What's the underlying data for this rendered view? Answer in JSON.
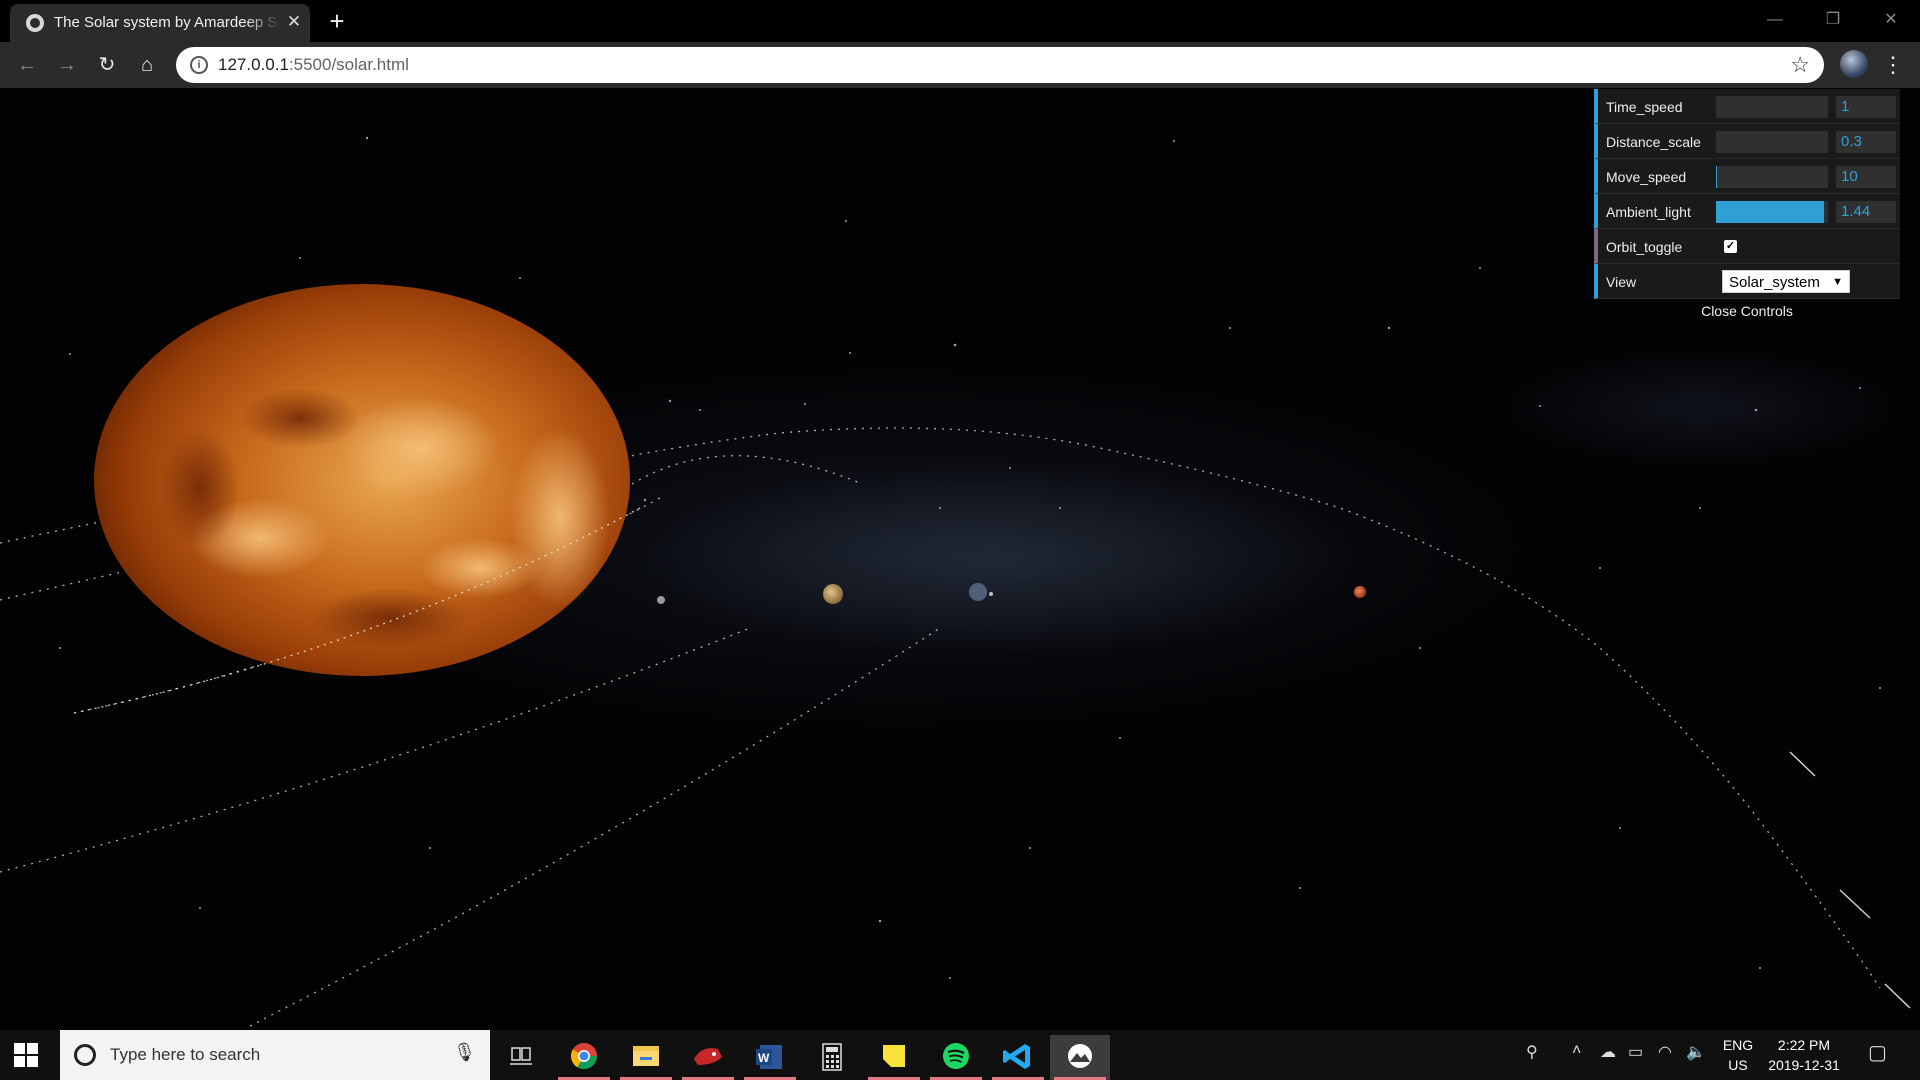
{
  "browser": {
    "tab_title": "The Solar system by Amardeep Singh",
    "tab_close": "✕",
    "new_tab": "+",
    "window_controls": {
      "minimize": "—",
      "maximize": "❐",
      "close": "✕"
    },
    "nav": {
      "back": "←",
      "forward": "→",
      "reload": "↻",
      "home": "⌂"
    },
    "url_host": "127.0.0.1",
    "url_rest": ":5500/solar.html",
    "star": "☆",
    "menu": "⋮"
  },
  "controls": {
    "time_speed": {
      "label": "Time_speed",
      "value": "1",
      "fill": 0.0
    },
    "distance_scale": {
      "label": "Distance_scale",
      "value": "0.3",
      "fill": 0.0
    },
    "move_speed": {
      "label": "Move_speed",
      "value": "10",
      "fill": 0.01
    },
    "ambient_light": {
      "label": "Ambient_light",
      "value": "1.44",
      "fill": 0.96
    },
    "orbit_toggle": {
      "label": "Orbit_toggle",
      "checked": true,
      "check_glyph": "✓"
    },
    "view": {
      "label": "View",
      "selected": "Solar_system",
      "arrow": "▼"
    },
    "close_label": "Close Controls"
  },
  "taskbar": {
    "search_placeholder": "Type here to search",
    "apps": [
      "task-view",
      "chrome",
      "file-explorer",
      "red-app",
      "word",
      "calculator",
      "sticky-notes",
      "spotify",
      "vscode",
      "snipping-app"
    ],
    "lang_top": "ENG",
    "lang_bottom": "US",
    "time": "2:22 PM",
    "date": "2019-12-31"
  },
  "colors": {
    "gui_accent": "#2fa1d6",
    "sun_inner": "#e3a049",
    "sun_outer": "#7a2a04",
    "taskbar_underline": "#e17a84"
  }
}
